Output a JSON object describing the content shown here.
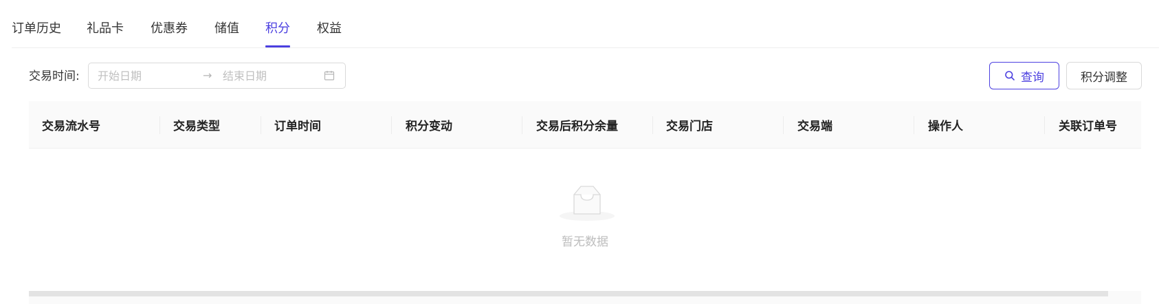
{
  "tabs": [
    {
      "label": "订单历史",
      "active": false
    },
    {
      "label": "礼品卡",
      "active": false
    },
    {
      "label": "优惠券",
      "active": false
    },
    {
      "label": "储值",
      "active": false
    },
    {
      "label": "积分",
      "active": true
    },
    {
      "label": "权益",
      "active": false
    }
  ],
  "filter": {
    "label": "交易时间:",
    "start_placeholder": "开始日期",
    "end_placeholder": "结束日期",
    "separator": "→",
    "start_value": "",
    "end_value": ""
  },
  "actions": {
    "query_label": "查询",
    "adjust_label": "积分调整"
  },
  "table": {
    "columns": [
      "交易流水号",
      "交易类型",
      "订单时间",
      "积分变动",
      "交易后积分余量",
      "交易门店",
      "交易端",
      "操作人",
      "关联订单号"
    ],
    "rows": [],
    "empty_text": "暂无数据"
  },
  "colors": {
    "accent": "#4b3fe0",
    "border": "#d9d9d9",
    "header_bg": "#fafafa",
    "placeholder": "#c0c0c0"
  },
  "icons": {
    "query": "search-icon",
    "date": "calendar-icon",
    "empty": "empty-inbox-icon"
  }
}
